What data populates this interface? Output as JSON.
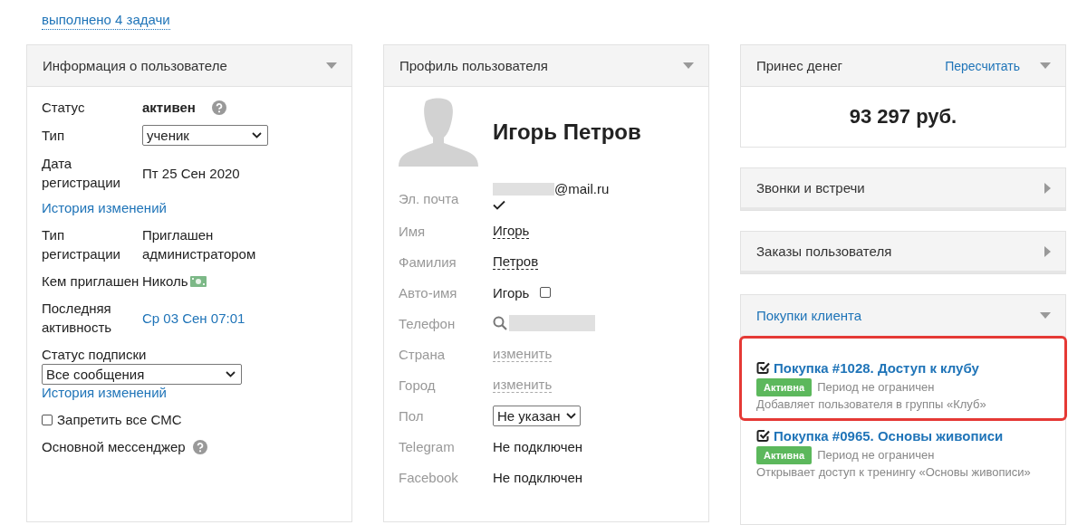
{
  "top_link": "выполнено 4 задачи",
  "user_info": {
    "title": "Информация о пользователе",
    "expanded": true,
    "rows": [
      {
        "kind": "status",
        "label": "Статус",
        "value": "активен"
      },
      {
        "kind": "select",
        "label": "Тип",
        "value": "ученик"
      },
      {
        "kind": "text",
        "label": "Дата регистрации",
        "value": "Пт 25 Сен 2020"
      },
      {
        "kind": "link",
        "value": "История изменений"
      },
      {
        "kind": "text",
        "label": "Тип регистрации",
        "value": "Приглашен администратором"
      },
      {
        "kind": "referrer",
        "label": "Кем приглашен",
        "value": "Николь"
      },
      {
        "kind": "link_value",
        "label": "Последняя активность",
        "value": "Ср 03 Сен 07:01"
      },
      {
        "kind": "stacked_select",
        "label": "Статус подписки",
        "value": "Все сообщения"
      },
      {
        "kind": "link",
        "value": "История изменений"
      },
      {
        "kind": "checkbox",
        "label": "Запретить все СМС",
        "checked": false
      },
      {
        "kind": "help_label",
        "label": "Основной мессенджер"
      }
    ]
  },
  "profile": {
    "title": "Профиль пользователя",
    "expanded": true,
    "name": "Игорь Петров",
    "fields": [
      {
        "kind": "email",
        "label": "Эл. почта",
        "value": "@mail.ru",
        "verified": true
      },
      {
        "kind": "editable",
        "label": "Имя",
        "value": "Игорь"
      },
      {
        "kind": "editable",
        "label": "Фамилия",
        "value": "Петров"
      },
      {
        "kind": "autoname",
        "label": "Авто-имя",
        "value": "Игорь",
        "checked": false
      },
      {
        "kind": "phone",
        "label": "Телефон"
      },
      {
        "kind": "empty_editable",
        "label": "Страна",
        "value": "изменить"
      },
      {
        "kind": "empty_editable",
        "label": "Город",
        "value": "изменить"
      },
      {
        "kind": "select",
        "label": "Пол",
        "value": "Не указан"
      },
      {
        "kind": "text",
        "label": "Telegram",
        "value": "Не подключен"
      },
      {
        "kind": "text",
        "label": "Facebook",
        "value": "Не подключен"
      }
    ]
  },
  "money": {
    "title": "Принес денег",
    "action": "Пересчитать",
    "expanded": true,
    "amount": "93 297 руб."
  },
  "collapsed_panels": [
    {
      "title": "Звонки и встречи",
      "expanded": false
    },
    {
      "title": "Заказы пользователя",
      "expanded": false
    }
  ],
  "purchases": {
    "title": "Покупки клиента",
    "expanded": true,
    "items": [
      {
        "title": "Покупка #1028. Доступ к клубу",
        "status": "Активна",
        "period": "Период не ограничен",
        "description": "Добавляет пользователя в группы «Клуб»",
        "highlighted": true
      },
      {
        "title": "Покупка #0965. Основы живописи",
        "status": "Активна",
        "period": "Период не ограничен",
        "description": "Открывает доступ к тренингу «Основы живописи»",
        "highlighted": false
      }
    ]
  }
}
